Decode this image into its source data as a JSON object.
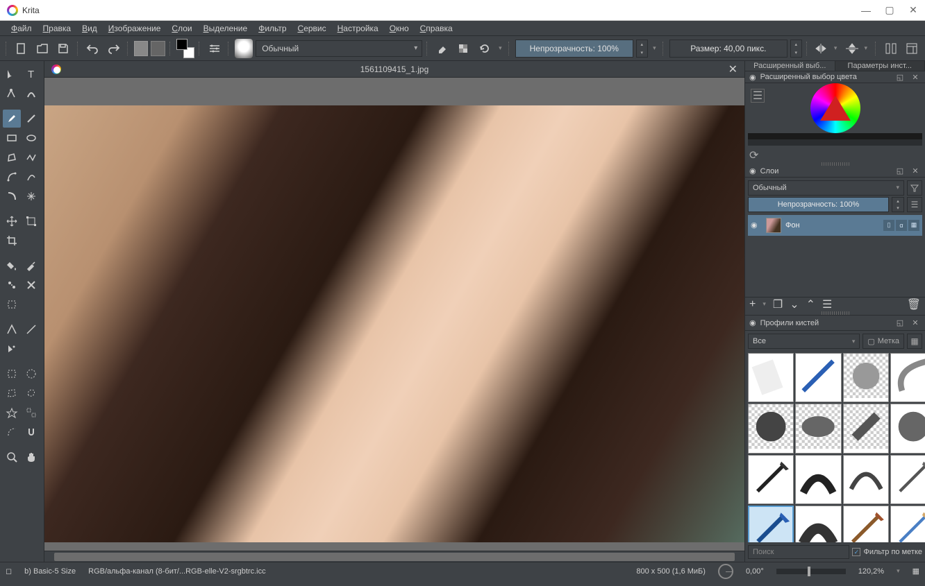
{
  "app_title": "Krita",
  "menu": [
    "Файл",
    "Правка",
    "Вид",
    "Изображение",
    "Слои",
    "Выделение",
    "Фильтр",
    "Сервис",
    "Настройка",
    "Окно",
    "Справка"
  ],
  "toolbar": {
    "blend_mode": "Обычный",
    "opacity_label": "Непрозрачность: 100%",
    "size_label": "Размер: 40,00 пикс."
  },
  "document": {
    "filename": "1561109415_1.jpg"
  },
  "dockers": {
    "tabs": [
      "Расширенный выб...",
      "Параметры инст..."
    ],
    "color_title": "Расширенный выбор цвета",
    "layers_title": "Слои",
    "layers_mode": "Обычный",
    "layers_opacity": "Непрозрачность:   100%",
    "layer_name": "Фон",
    "brushes_title": "Профили кистей",
    "brushes_filter": "Все",
    "tag_label": "Метка",
    "search_placeholder": "Поиск",
    "filter_by_tag": "Фильтр по метке"
  },
  "status": {
    "brush": "b) Basic-5 Size",
    "profile": "RGB/альфа-канал (8-бит/...RGB-elle-V2-srgbtrc.icc",
    "dims": "800 x 500 (1,6 МиБ)",
    "angle": "0,00°",
    "zoom": "120,2%"
  }
}
